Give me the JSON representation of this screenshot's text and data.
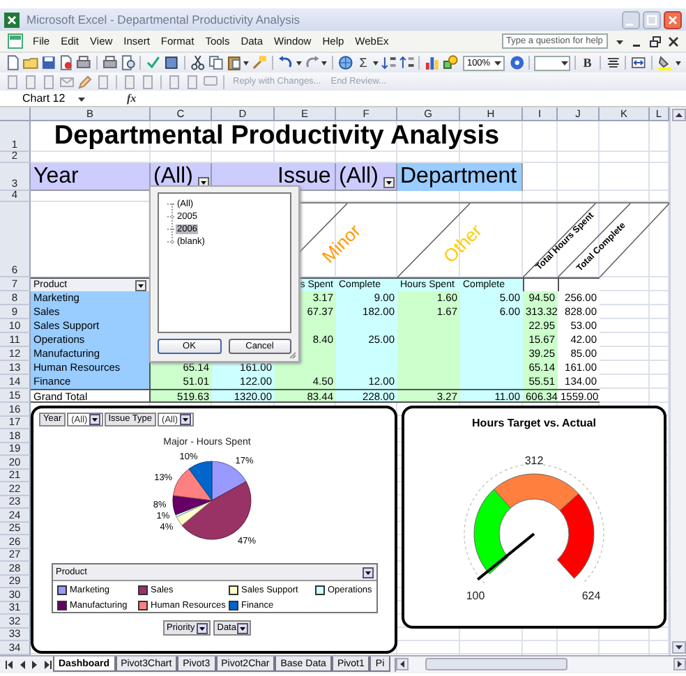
{
  "window": {
    "title": "Microsoft Excel - Departmental Productivity Analysis"
  },
  "menu": [
    "File",
    "Edit",
    "View",
    "Insert",
    "Format",
    "Tools",
    "Data",
    "Window",
    "Help",
    "WebEx"
  ],
  "help_field": {
    "placeholder": "Type a question for help"
  },
  "toolbar": {
    "sum": "Σ",
    "zoom": "100%",
    "bold": "B"
  },
  "review_toolbar": [
    {
      "label": "Reply with Changes...",
      "disabled": true
    },
    {
      "label": "End Review...",
      "disabled": true
    }
  ],
  "name_box": "Chart 12",
  "formula_label": "fx",
  "column_headers": [
    "B",
    "C",
    "D",
    "E",
    "F",
    "G",
    "H",
    "I",
    "J",
    "K",
    "L"
  ],
  "row_headers": [
    "1",
    "2",
    "3",
    "4",
    "6",
    "7",
    "8",
    "9",
    "10",
    "11",
    "12",
    "13",
    "14",
    "15",
    "16",
    "17",
    "18",
    "19",
    "20",
    "21",
    "22",
    "23",
    "24",
    "25",
    "26",
    "27",
    "28",
    "29",
    "30",
    "31",
    "32",
    "33",
    "34"
  ],
  "pivot": {
    "title": "Departmental Productivity Analysis",
    "page_fields": [
      {
        "label": "Year",
        "value": "(All)"
      },
      {
        "label": "Issue",
        "value": "(All)"
      }
    ],
    "column_field": "Department",
    "groups": [
      {
        "label": "Minor",
        "color": "#ff9900"
      },
      {
        "label": "Other",
        "color": "#ffcc00"
      }
    ],
    "totals": [
      "Total Hours Spent",
      "Total Complete"
    ],
    "row_field": "Product",
    "headers": [
      "s Spent",
      "Complete",
      "Hours Spent",
      "Complete"
    ],
    "rows": [
      {
        "kind": "item",
        "name": "Marketing",
        "values": {
          "E": "3.17",
          "F": "9.00",
          "G": "1.60",
          "H": "5.00",
          "I": "94.50",
          "J": "256.00"
        }
      },
      {
        "kind": "item",
        "name": "Sales",
        "values": {
          "E": "67.37",
          "F": "182.00",
          "G": "1.67",
          "H": "6.00",
          "I": "313.32",
          "J": "828.00"
        }
      },
      {
        "kind": "item",
        "name": "Sales Support",
        "values": {
          "I": "22.95",
          "J": "53.00"
        }
      },
      {
        "kind": "item",
        "name": "Operations",
        "values": {
          "E": "8.40",
          "F": "25.00",
          "I": "15.67",
          "J": "42.00"
        }
      },
      {
        "kind": "item",
        "name": "Manufacturing",
        "values": {
          "I": "39.25",
          "J": "85.00"
        }
      },
      {
        "kind": "item",
        "name": "Human Resources",
        "values": {
          "C": "65.14",
          "D": "161.00",
          "I": "65.14",
          "J": "161.00"
        }
      },
      {
        "kind": "item",
        "name": "Finance",
        "values": {
          "C": "51.01",
          "D": "122.00",
          "E": "4.50",
          "F": "12.00",
          "I": "55.51",
          "J": "134.00"
        }
      },
      {
        "kind": "total",
        "name": "Grand Total",
        "values": {
          "C": "519.63",
          "D": "1320.00",
          "E": "83.44",
          "F": "228.00",
          "G": "3.27",
          "H": "11.00",
          "I": "606.34",
          "J": "1559.00"
        }
      }
    ]
  },
  "filter_popup": {
    "items": [
      {
        "label": "(All)",
        "selected": false
      },
      {
        "label": "2005",
        "selected": false
      },
      {
        "label": "2006",
        "selected": true
      },
      {
        "label": "(blank)",
        "selected": false
      }
    ],
    "buttons": [
      "OK",
      "Cancel"
    ]
  },
  "pie_chart": {
    "page_fields": [
      {
        "label": "Year",
        "value": "(All)"
      },
      {
        "label": "Issue Type",
        "value": "(All)"
      }
    ],
    "chart_data": {
      "type": "pie",
      "title": "Major - Hours Spent",
      "categories": [
        "Marketing",
        "Sales",
        "Sales Support",
        "Operations",
        "Manufacturing",
        "Human Resources",
        "Finance"
      ],
      "values": [
        17,
        47,
        4,
        1,
        8,
        13,
        10
      ],
      "value_labels": [
        "17%",
        "47%",
        "4%",
        "1%",
        "8%",
        "13%",
        "10%"
      ]
    },
    "legend": {
      "title": "Product",
      "items": [
        {
          "color": "#9999ff"
        },
        {
          "color": "#993366"
        },
        {
          "color": "#ffffcc"
        },
        {
          "color": "#ccffff"
        },
        {
          "color": "#660066"
        },
        {
          "color": "#ff8080"
        },
        {
          "color": "#0066cc"
        }
      ]
    },
    "field_buttons": [
      "Priority",
      "Data"
    ]
  },
  "gauge": {
    "title": "Hours Target vs. Actual",
    "labels": [
      "100",
      "312",
      "624"
    ]
  },
  "sheet_tabs": [
    {
      "label": "Dashboard",
      "selected": true
    },
    {
      "label": "Pivot3Chart",
      "selected": false
    },
    {
      "label": "Pivot3",
      "selected": false
    },
    {
      "label": "Pivot2Char",
      "selected": false
    },
    {
      "label": "Base Data",
      "selected": false
    },
    {
      "label": "Pivot1",
      "selected": false
    },
    {
      "label": "Pi",
      "selected": false
    }
  ]
}
